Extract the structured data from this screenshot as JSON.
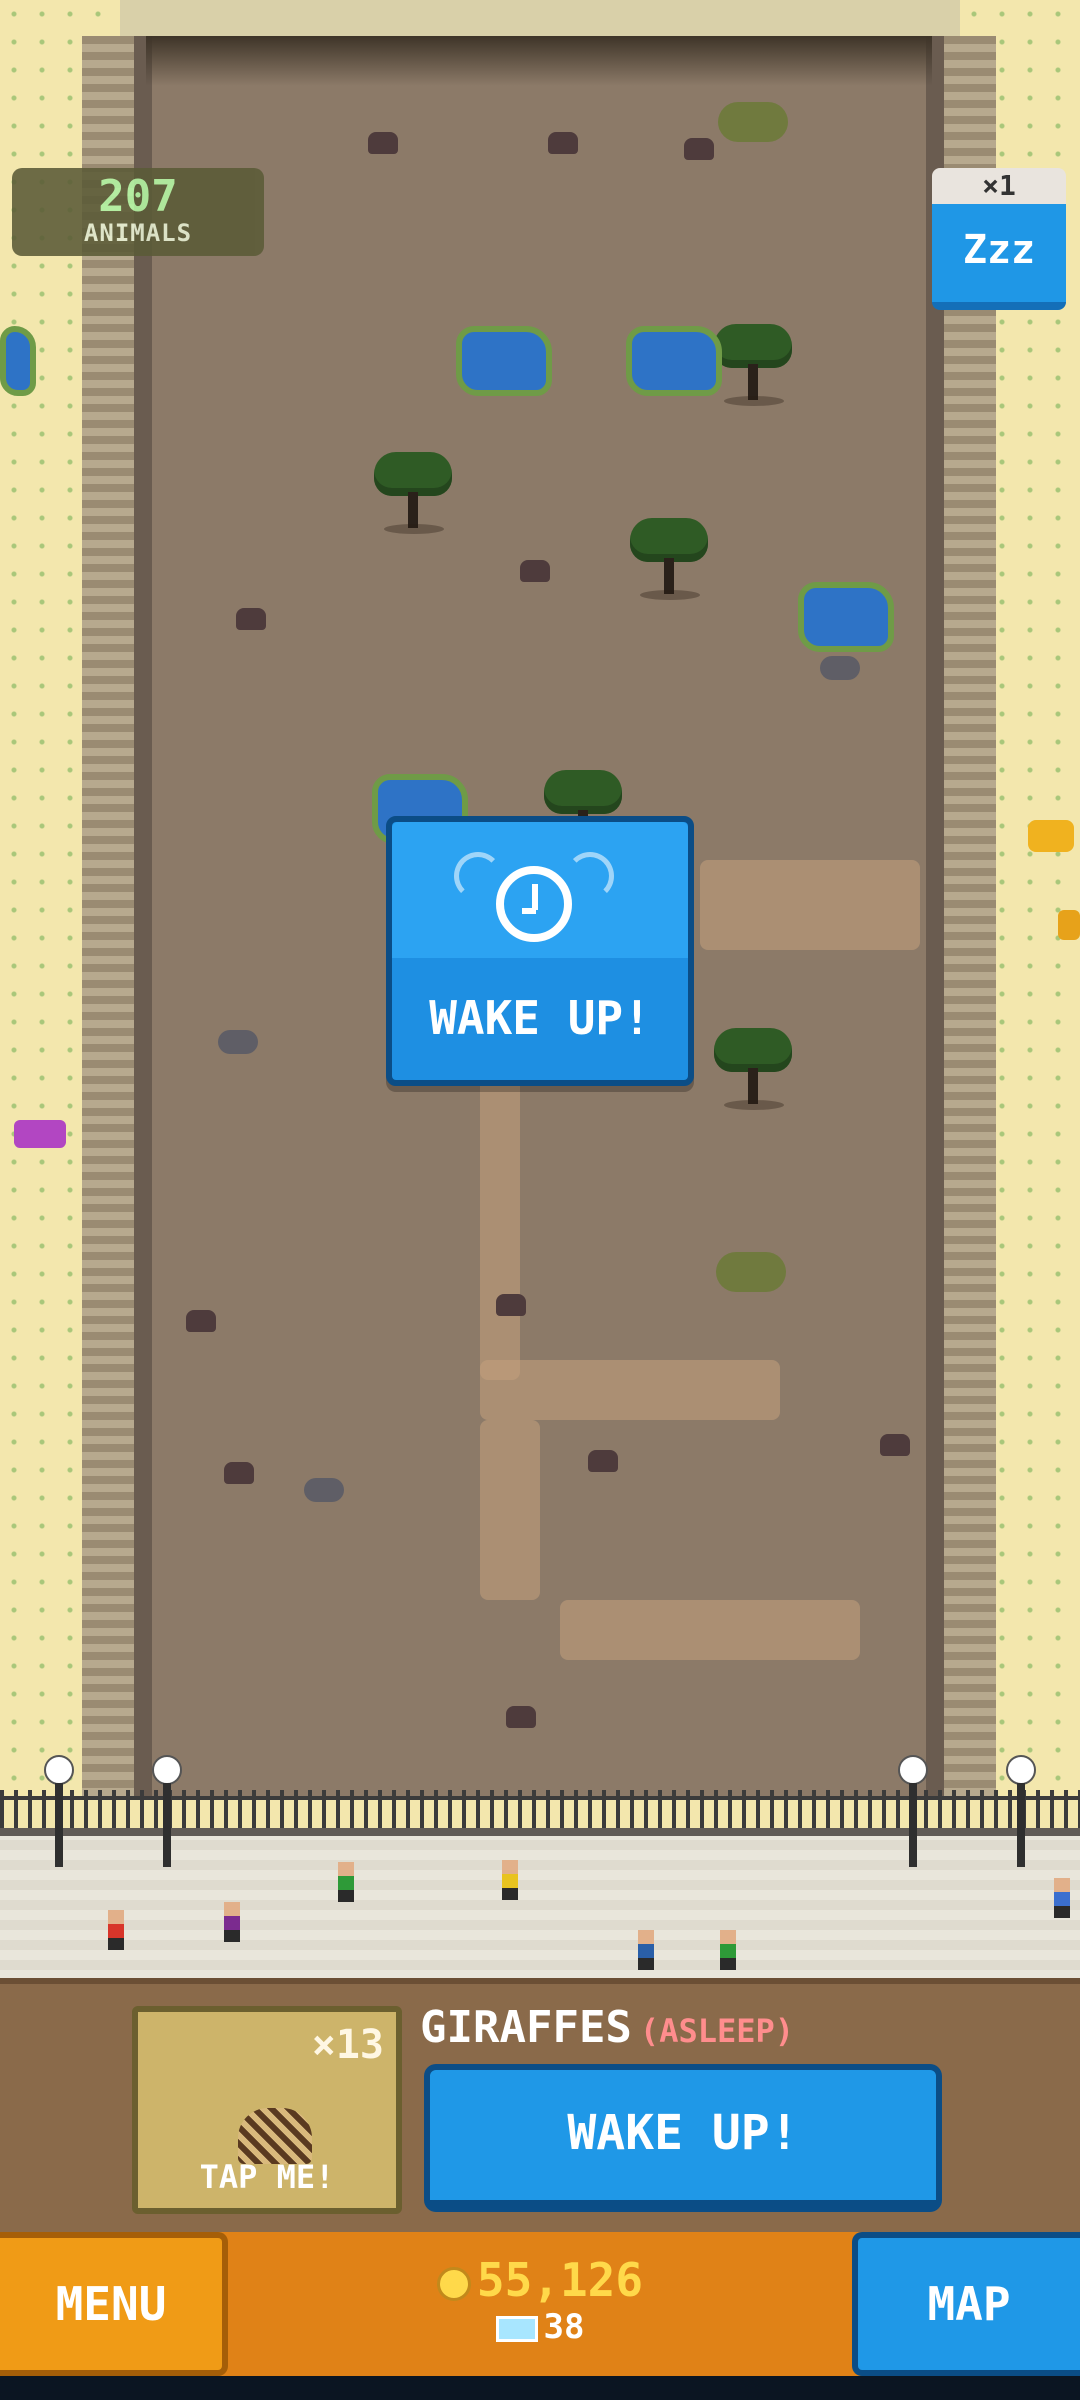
{
  "hud": {
    "animal_count": "207",
    "animal_label": "ANIMALS",
    "sleep_multiplier": "×1",
    "sleep_icon_text": "Zzz"
  },
  "popup": {
    "label": "WAKE UP!"
  },
  "panel": {
    "tap_card": {
      "multiplier": "×13",
      "label": "TAP ME!"
    },
    "title": "GIRAFFES",
    "status": "(ASLEEP)",
    "wake_button": "WAKE UP!"
  },
  "bottom_bar": {
    "menu": "MENU",
    "coins": "55,126",
    "gems": "38",
    "map": "MAP"
  },
  "colors": {
    "accent_blue": "#1f98e7",
    "accent_orange": "#f09b16",
    "status_red": "#ff8d8d",
    "count_green": "#b4f7a4"
  }
}
